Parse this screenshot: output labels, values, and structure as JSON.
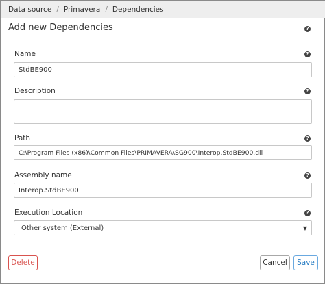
{
  "breadcrumb": {
    "items": [
      "Data source",
      "Primavera",
      "Dependencies"
    ],
    "separator": "/"
  },
  "dialog": {
    "title": "Add new Dependencies",
    "help_glyph": "?"
  },
  "form": {
    "name": {
      "label": "Name",
      "value": "StdBE900"
    },
    "description": {
      "label": "Description",
      "value": ""
    },
    "path": {
      "label": "Path",
      "value": "C:\\Program Files (x86)\\Common Files\\PRIMAVERA\\SG900\\Interop.StdBE900.dll"
    },
    "assembly_name": {
      "label": "Assembly name",
      "value": "Interop.StdBE900"
    },
    "execution_location": {
      "label": "Execution Location",
      "selected": "Other system (External)"
    }
  },
  "actions": {
    "delete_label": "Delete",
    "cancel_label": "Cancel",
    "save_label": "Save"
  },
  "colors": {
    "danger": "#d9534f",
    "primary": "#2a7ec4",
    "breadcrumb_bg": "#eeeeee"
  }
}
